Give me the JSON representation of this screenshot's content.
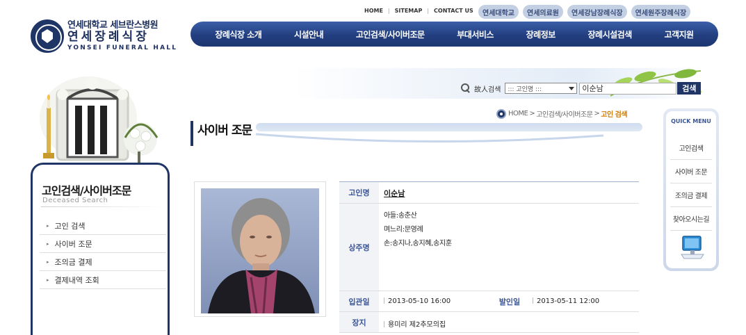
{
  "header": {
    "logo": {
      "line1": "연세대학교 세브란스병원",
      "line2": "연세장례식장",
      "line3": "YONSEI FUNERAL HALL"
    },
    "util_links": [
      "HOME",
      "SITEMAP",
      "CONTACT US"
    ],
    "hospital_buttons": [
      "연세대학교",
      "연세의료원",
      "연세강남장례식장",
      "연세원주장례식장"
    ],
    "gnb": [
      "장례식장 소개",
      "시설안내",
      "고인검색/사이버조문",
      "부대서비스",
      "장례정보",
      "장례시설검색",
      "고객지원"
    ]
  },
  "sidebar": {
    "title": "고인검색/사이버조문",
    "subtitle": "Deceased Search",
    "items": [
      "고인 검색",
      "사이버 조문",
      "조의금 결제",
      "결제내역 조회"
    ]
  },
  "search": {
    "label": "故人검색",
    "select_value": "::: 고인명 :::",
    "input_value": "이순남",
    "button": "검색"
  },
  "breadcrumb": {
    "home": "HOME",
    "mid": "고인검색/사이버조문",
    "current": "고인 검색",
    "sep": ">"
  },
  "page": {
    "title": "사이버 조문"
  },
  "deceased": {
    "name_label": "고인명",
    "name": "이순남",
    "mourners_label": "상주명",
    "mourners": [
      "아들:송춘산",
      "며느리:문영례",
      "손:송지나,송지혜,송지훈"
    ],
    "encoffin_label": "입관일",
    "encoffin_date": "2013-05-10 16:00",
    "departure_label": "발인일",
    "departure_date": "2013-05-11 12:00",
    "place_label": "장지",
    "place": "용미리 제2추모의집"
  },
  "quick_menu": {
    "title": "QUICK MENU",
    "items": [
      "고인검색",
      "사이버 조문",
      "조의금 결제",
      "찾아오시는길"
    ]
  },
  "colors": {
    "navy": "#1f3566",
    "nav_gradient_top": "#3b5fa8",
    "label_blue": "#3a5596",
    "breadcrumb_current": "#d17b00"
  }
}
